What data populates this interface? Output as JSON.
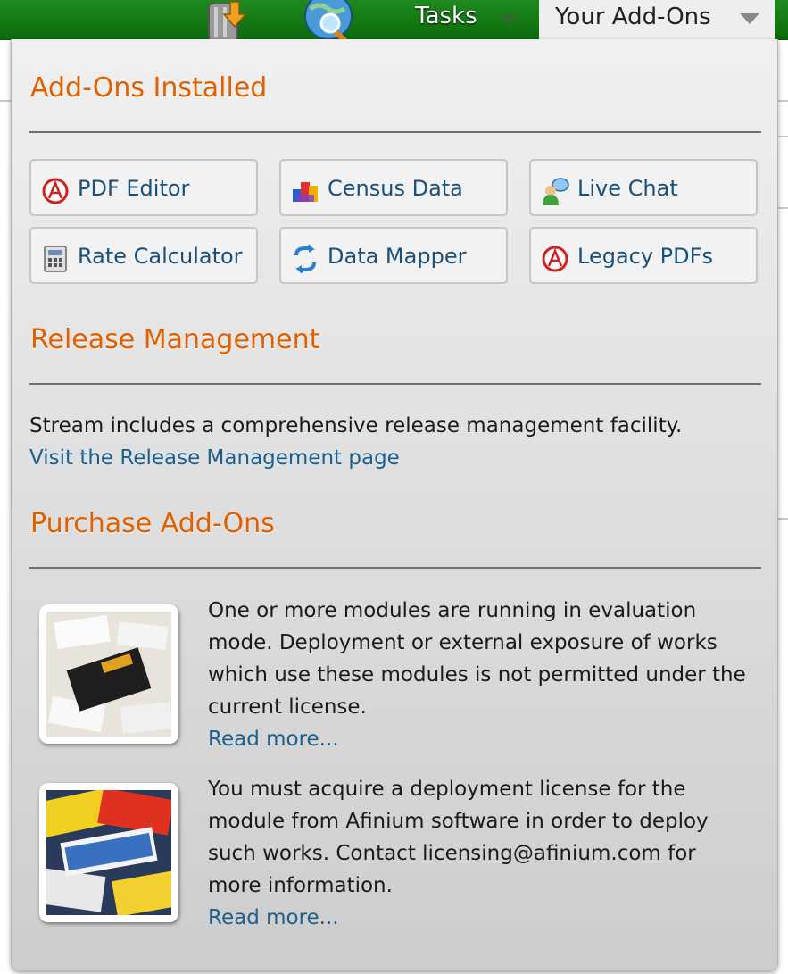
{
  "topbar": {
    "tasks_label": "Tasks",
    "addons_label": "Your Add-Ons",
    "icons": [
      "trash-download-icon",
      "globe-search-icon"
    ]
  },
  "installed": {
    "heading": "Add-Ons Installed",
    "tiles": [
      {
        "label": "PDF Editor",
        "icon": "pdf-icon"
      },
      {
        "label": "Census Data",
        "icon": "census-data-icon"
      },
      {
        "label": "Live Chat",
        "icon": "live-chat-icon"
      },
      {
        "label": "Rate Calculator",
        "icon": "calculator-icon"
      },
      {
        "label": "Data Mapper",
        "icon": "data-mapper-icon"
      },
      {
        "label": "Legacy PDFs",
        "icon": "pdf-icon"
      }
    ]
  },
  "release": {
    "heading": "Release Management",
    "text": "Stream includes a comprehensive release management facility.",
    "link": "Visit the Release Management page"
  },
  "purchase": {
    "heading": "Purchase Add-Ons",
    "items": [
      {
        "lines": [
          "One or more modules are running in evaluation",
          "mode. Deployment or external exposure of works",
          "which use these modules is not permitted under the",
          "current license."
        ],
        "link": "Read more..."
      },
      {
        "lines": [
          "You must acquire a deployment license for the",
          "module from Afinium software in order to deploy",
          "such works. Contact licensing@afinium.com for",
          "more information."
        ],
        "link": "Read more..."
      }
    ]
  },
  "colors": {
    "accent_orange": "#e06000",
    "link_blue": "#1a5f8f",
    "topbar_green": "#0b6a0b"
  }
}
